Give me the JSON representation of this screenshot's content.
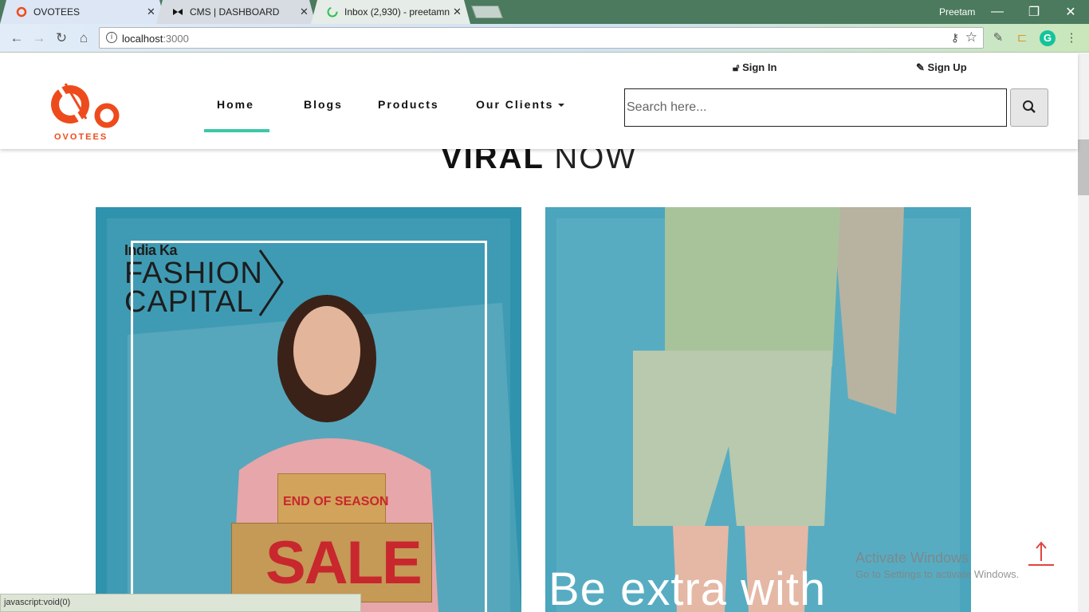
{
  "browser": {
    "tabs": [
      {
        "title": "OVOTEES",
        "active": true
      },
      {
        "title": "CMS | DASHBOARD",
        "active": false
      },
      {
        "title": "Inbox (2,930) - preetamn",
        "active": false
      }
    ],
    "profile_name": "Preetam",
    "url_host": "localhost",
    "url_port": ":3000",
    "status_text": "javascript:void(0)"
  },
  "site": {
    "brand": "OVOTEES",
    "auth": {
      "sign_in": "Sign In",
      "sign_up": "Sign Up"
    },
    "nav": [
      {
        "label": "Home",
        "active": true
      },
      {
        "label": "Blogs",
        "active": false
      },
      {
        "label": "Products",
        "active": false
      },
      {
        "label": "Our Clients",
        "active": false,
        "dropdown": true
      }
    ],
    "search": {
      "placeholder": "Search here..."
    },
    "accent_color": "#3cc7a8",
    "brand_color": "#ee4b1c"
  },
  "main": {
    "heading_bold": "VIRAL",
    "heading_light": "NOW",
    "cards": [
      {
        "promo_small": "India Ka",
        "promo_line1": "FASHION",
        "promo_line2": "CAPITAL",
        "box_small": "END OF SEASON",
        "box_big": "SALE"
      },
      {
        "caption": "Be extra with"
      }
    ]
  },
  "os": {
    "activate_title": "Activate Windows",
    "activate_sub": "Go to Settings to activate Windows."
  }
}
